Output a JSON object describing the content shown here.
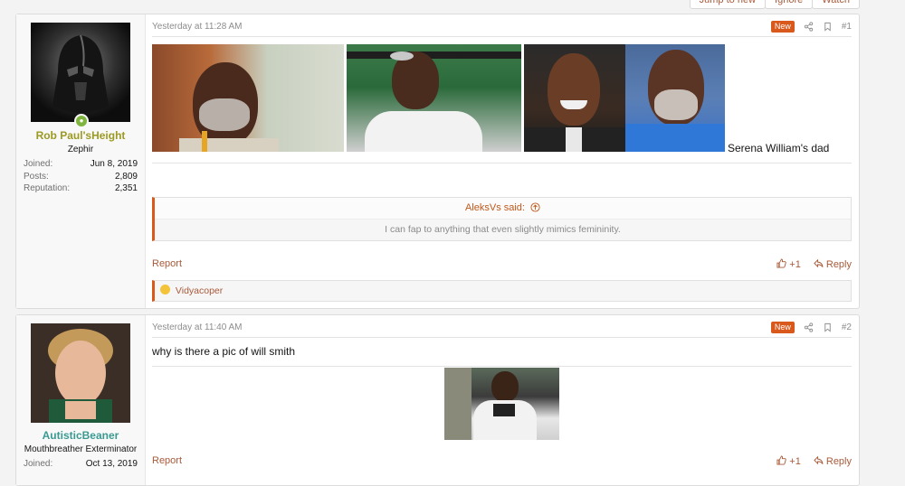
{
  "top_buttons": [
    "Jump to new",
    "Ignore",
    "Watch"
  ],
  "posts": [
    {
      "user": {
        "name": "Rob Paul'sHeight",
        "title": "Zephir",
        "name_color": "#9c9a22",
        "stats": [
          {
            "k": "Joined:",
            "v": "Jun 8, 2019"
          },
          {
            "k": "Posts:",
            "v": "2,809"
          },
          {
            "k": "Reputation:",
            "v": "2,351"
          }
        ]
      },
      "time": "Yesterday at 11:28 AM",
      "badge": "New",
      "num": "#1",
      "caption": "Serena William's dad",
      "quote": {
        "author": "AleksVs said:",
        "text": "I can fap to anything that even slightly mimics femininity."
      },
      "report": "Report",
      "like": "+1",
      "reply": "Reply",
      "reaction_user": "Vidyacoper"
    },
    {
      "user": {
        "name": "AutisticBeaner",
        "title": "Mouthbreather Exterminator",
        "name_color": "#3a9a92",
        "stats": [
          {
            "k": "Joined:",
            "v": "Oct 13, 2019"
          }
        ]
      },
      "time": "Yesterday at 11:40 AM",
      "badge": "New",
      "num": "#2",
      "body": "why is there a pic of will smith",
      "report": "Report",
      "like": "+1",
      "reply": "Reply"
    }
  ],
  "colors": {
    "accent": "#d9581b",
    "link": "#a95a3a"
  }
}
